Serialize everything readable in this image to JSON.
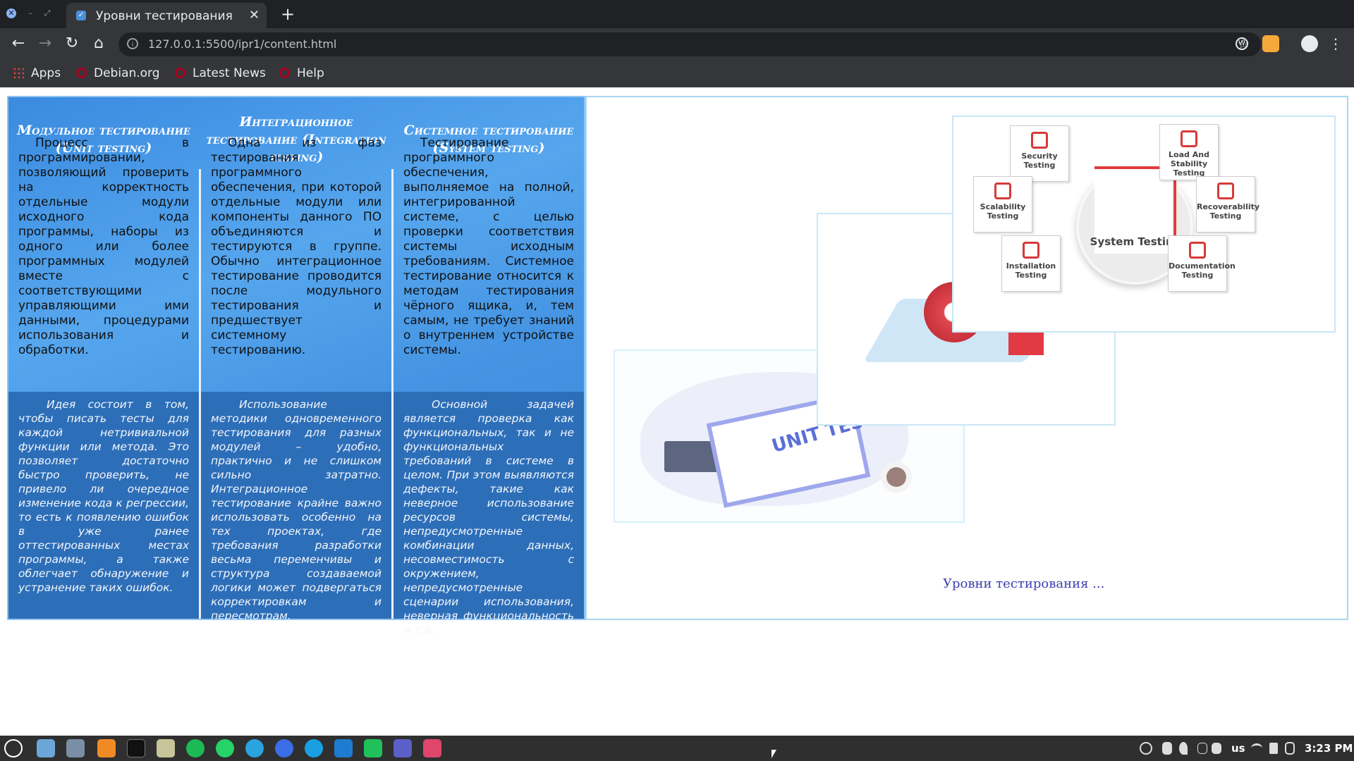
{
  "browser": {
    "tab_title": "Уровни тестирования",
    "url": "127.0.0.1:5500/ipr1/content.html",
    "bookmarks": [
      {
        "label": "Apps"
      },
      {
        "label": "Debian.org"
      },
      {
        "label": "Latest News"
      },
      {
        "label": "Help"
      }
    ]
  },
  "table": {
    "columns": [
      {
        "heading": "Модульное тестирование (Unit testing)",
        "description": "Процесс в программировании, позволяющий проверить на корректность отдельные модули исходного кода программы, наборы из одного или более программных модулей вместе с соответствующими управляющими ими данными, процедурами использования и обработки.",
        "idea": "Идея состоит в том, чтобы писать тесты для каждой нетривиальной функции или метода. Это позволяет достаточно быстро проверить, не привело ли очередное изменение кода к регрессии, то есть к появлению ошибок в уже ранее оттестированных местах программы, а также облегчает обнаружение и устранение таких ошибок."
      },
      {
        "heading": "Интеграционное тестирование (Integration testing)",
        "description": "Одна из фаз тестирования программного обеспечения, при которой отдельные модули или компоненты данного ПО объединяются и тестируются в группе. Обычно интеграционное тестирование проводится после модульного тестирования и предшествует системному тестированию.",
        "idea": "Использование методики одновременного тестирования для разных модулей – удобно, практично и не слишком сильно затратно. Интеграционное тестирование крайне важно использовать особенно на тех проектах, где требования разработки весьма переменчивы и структура создаваемой логики может подвергаться корректировкам и пересмотрам."
      },
      {
        "heading": "Системное тестирование (System testing)",
        "description": "Тестирование программного обеспечения, выполняемое на полной, интегрированной системе, с целью проверки соответствия системы исходным требованиям. Системное тестирование относится к методам тестирования чёрного ящика, и, тем самым, не требует знаний о внутреннем устройстве системы.",
        "idea": "Основной задачей является проверка как функциональных, так и не функциональных требований в системе в целом. При этом выявляются дефекты, такие как неверное использование ресурсов системы, непредусмотренные комбинации данных, несовместимость с окружением, непредусмотренные сценарии использования, неверная функциональность и т.д."
      }
    ]
  },
  "slideshow": {
    "caption": "Уровни тестирования ...",
    "unit_tests_label": "UNIT TESTS",
    "system_testing_label": "System Testing",
    "system_boxes": [
      {
        "label": "Security Testing"
      },
      {
        "label": "Load And Stability Testing"
      },
      {
        "label": "Scalability Testing"
      },
      {
        "label": "Recoverability Testing"
      },
      {
        "label": "Installation Testing"
      },
      {
        "label": "Documentation Testing"
      }
    ]
  },
  "taskbar": {
    "keyboard_layout": "us",
    "clock": "3:23 PM"
  }
}
